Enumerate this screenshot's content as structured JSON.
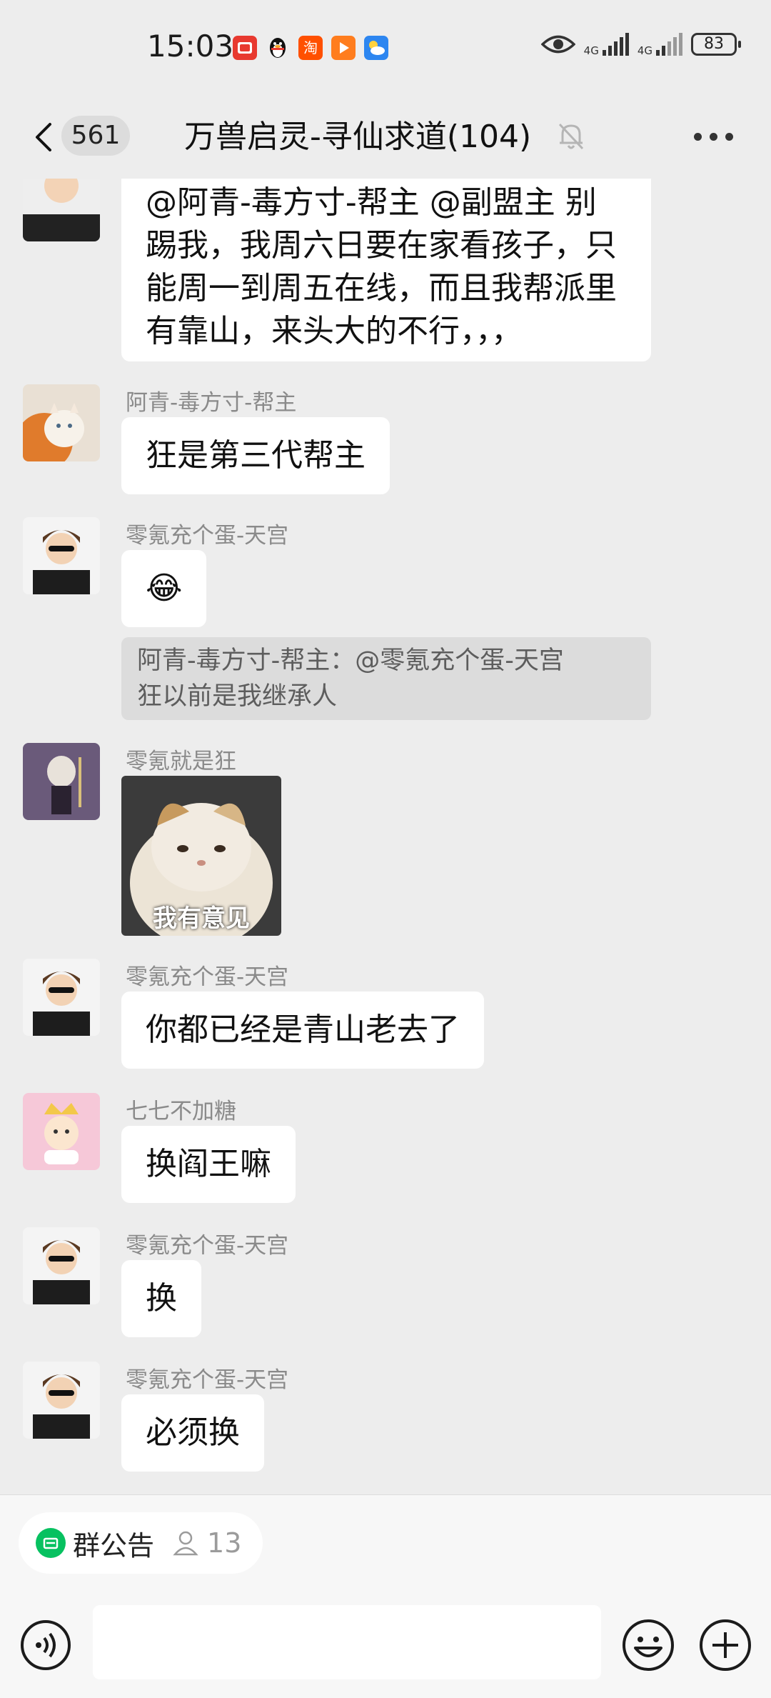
{
  "status_bar": {
    "time": "15:03",
    "apps": [
      {
        "icon": "red-app-icon",
        "color": "#e8392f",
        "glyph": "▬"
      },
      {
        "icon": "qq-penguin-icon",
        "color": "#ffffff",
        "glyph": "🐧"
      },
      {
        "icon": "taobao-icon",
        "color": "#ff5000",
        "glyph": "淘"
      },
      {
        "icon": "video-play-icon",
        "color": "#ff7d1e",
        "glyph": "▶"
      },
      {
        "icon": "weather-icon",
        "color": "#2d86f0",
        "glyph": "☁"
      }
    ],
    "network_1": "4G",
    "network_2": "4G",
    "battery": "83"
  },
  "header": {
    "back_count": "561",
    "title": "万兽启灵-寻仙求道(104)"
  },
  "messages": [
    {
      "type": "text-cont",
      "text_lines": [
        "@阿青-毒方寸-帮主  @副盟主  别",
        "踢我，我周六日要在家看孩子，只",
        "能周一到周五在线，而且我帮派里",
        "有靠山，来头大的不行，，，"
      ]
    },
    {
      "sender": "阿青-毒方寸-帮主",
      "text": "狂是第三代帮主"
    },
    {
      "sender": "零氪充个蛋-天宫",
      "emoji": "😂"
    },
    {
      "quote_lines": [
        "阿青-毒方寸-帮主：@零氪充个蛋-天宫",
        "狂以前是我继承人"
      ]
    },
    {
      "sender": "零氪就是狂",
      "sticker_caption": "我有意见"
    },
    {
      "sender": "零氪充个蛋-天宫",
      "text": "你都已经是青山老去了"
    },
    {
      "sender": "七七不加糖",
      "text": "换阎王嘛"
    },
    {
      "sender": "零氪充个蛋-天宫",
      "text": "换"
    },
    {
      "sender": "零氪充个蛋-天宫",
      "text": "必须换"
    }
  ],
  "bottom": {
    "notice_label": "群公告",
    "notice_count": "13",
    "input_placeholder": ""
  },
  "colors": {
    "accent": "#07c160",
    "background": "#ededed",
    "bubble": "#ffffff"
  }
}
